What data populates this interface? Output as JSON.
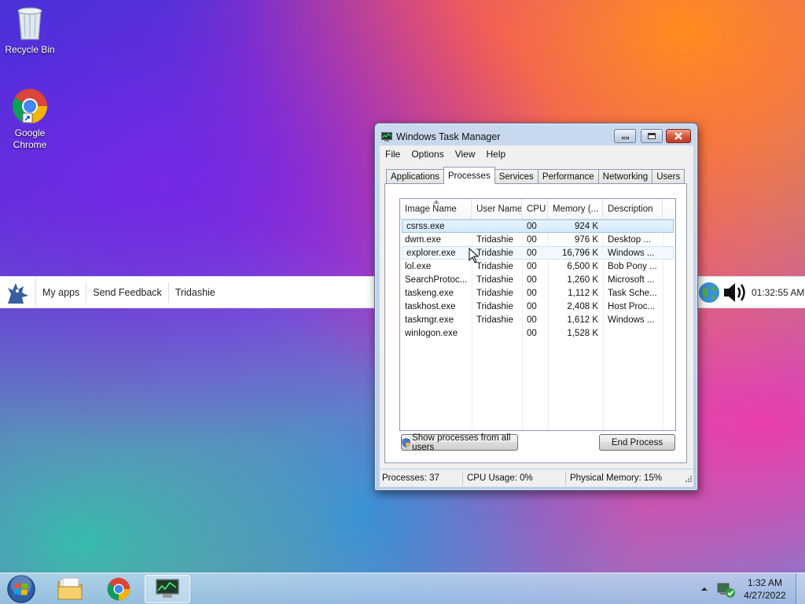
{
  "desktop": {
    "icons": [
      {
        "label": "Recycle Bin",
        "icon": "recycle-bin-icon"
      },
      {
        "label": "Google Chrome",
        "label_line1": "Google",
        "label_line2": "Chrome",
        "icon": "chrome-icon"
      }
    ]
  },
  "widget_bar": {
    "items": [
      "My apps",
      "Send Feedback",
      "Tridashie"
    ],
    "time": "01:32:55 AM"
  },
  "task_manager": {
    "title": "Windows Task Manager",
    "menu": [
      "File",
      "Options",
      "View",
      "Help"
    ],
    "tabs": [
      "Applications",
      "Processes",
      "Services",
      "Performance",
      "Networking",
      "Users"
    ],
    "active_tab": "Processes",
    "columns": [
      "Image Name",
      "User Name",
      "CPU",
      "Memory (...",
      "Description"
    ],
    "processes": [
      {
        "image": "csrss.exe",
        "user": "",
        "cpu": "00",
        "memory": "924 K",
        "description": ""
      },
      {
        "image": "dwm.exe",
        "user": "Tridashie",
        "cpu": "00",
        "memory": "976 K",
        "description": "Desktop ..."
      },
      {
        "image": "explorer.exe",
        "user": "Tridashie",
        "cpu": "00",
        "memory": "16,796 K",
        "description": "Windows ..."
      },
      {
        "image": "lol.exe",
        "user": "Tridashie",
        "cpu": "00",
        "memory": "6,500 K",
        "description": "Bob Pony ..."
      },
      {
        "image": "SearchProtoc...",
        "user": "Tridashie",
        "cpu": "00",
        "memory": "1,260 K",
        "description": "Microsoft ..."
      },
      {
        "image": "taskeng.exe",
        "user": "Tridashie",
        "cpu": "00",
        "memory": "1,112 K",
        "description": "Task Sche..."
      },
      {
        "image": "taskhost.exe",
        "user": "Tridashie",
        "cpu": "00",
        "memory": "2,408 K",
        "description": "Host Proc..."
      },
      {
        "image": "taskmgr.exe",
        "user": "Tridashie",
        "cpu": "00",
        "memory": "1,612 K",
        "description": "Windows ..."
      },
      {
        "image": "winlogon.exe",
        "user": "",
        "cpu": "00",
        "memory": "1,528 K",
        "description": ""
      }
    ],
    "show_all_button": "Show processes from all users",
    "end_process_button": "End Process",
    "status": {
      "processes": "Processes: 37",
      "cpu": "CPU Usage: 0%",
      "memory": "Physical Memory: 15%"
    }
  },
  "taskbar": {
    "pinned": [
      "start-orb-icon",
      "file-explorer-icon",
      "chrome-icon",
      "task-manager-icon"
    ],
    "clock_time": "1:32 AM",
    "clock_date": "4/27/2022"
  },
  "colors": {
    "title_bar": "#c9d9ee",
    "close_button": "#c0382a",
    "selected_row": "#d3e8fb",
    "taskbar": "#a0c3e6"
  }
}
